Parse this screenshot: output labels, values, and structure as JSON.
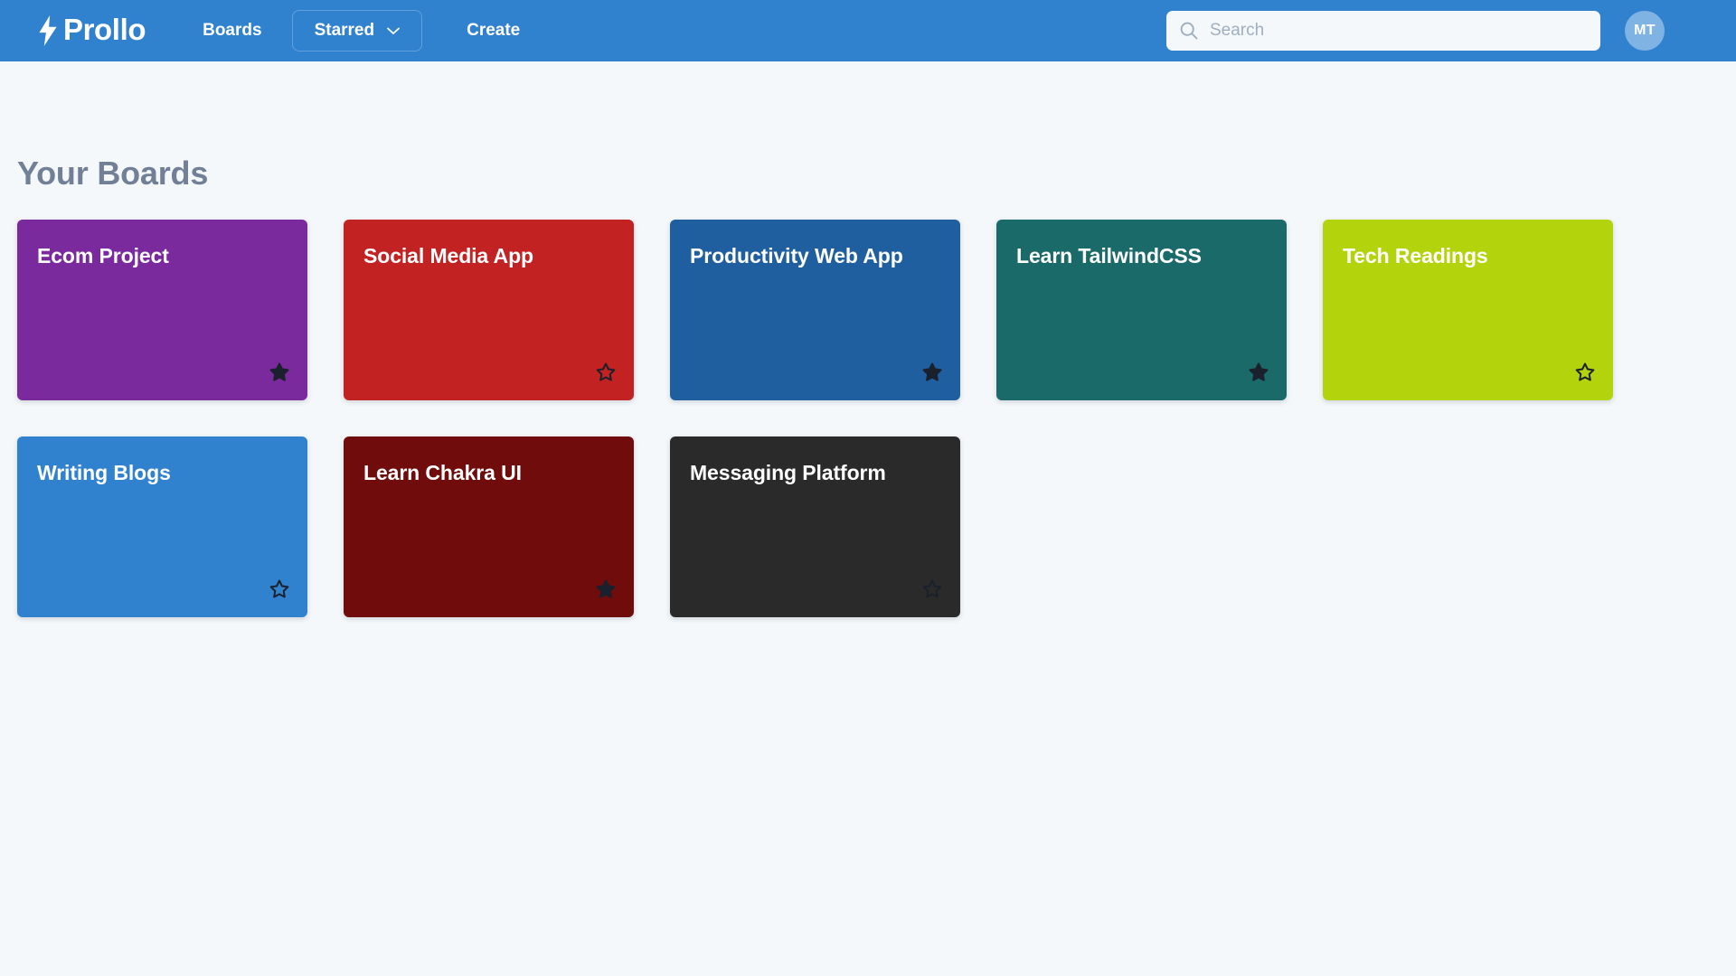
{
  "app": {
    "brand": "Prollo",
    "brand_icon": "lightning-bolt-icon",
    "navbar_color": "#3182ce",
    "page_background": "#f4f8fb"
  },
  "navbar": {
    "links": [
      {
        "label": "Boards",
        "type": "link"
      },
      {
        "label": "Starred",
        "type": "dropdown",
        "icon": "chevron-down-icon"
      },
      {
        "label": "Create",
        "type": "link"
      }
    ],
    "search": {
      "icon": "search-icon",
      "placeholder": "Search",
      "value": ""
    },
    "avatar": {
      "initials": "MT",
      "color": "#7fb3e4"
    }
  },
  "main": {
    "page_title": "Your Boards",
    "title_color": "#718096",
    "boards": [
      {
        "title": "Ecom Project",
        "color": "#7b2a9d",
        "starred": true,
        "star_icon": "star-filled-icon"
      },
      {
        "title": "Social Media App",
        "color": "#c32222",
        "starred": false,
        "star_icon": "star-outline-icon"
      },
      {
        "title": "Productivity Web App",
        "color": "#1f5fa0",
        "starred": true,
        "star_icon": "star-filled-icon"
      },
      {
        "title": "Learn TailwindCSS",
        "color": "#1b6a6a",
        "starred": true,
        "star_icon": "star-filled-icon"
      },
      {
        "title": "Tech Readings",
        "color": "#b3d40c",
        "starred": false,
        "star_icon": "star-outline-icon"
      },
      {
        "title": "Writing Blogs",
        "color": "#3182ce",
        "starred": false,
        "star_icon": "star-outline-icon"
      },
      {
        "title": "Learn Chakra UI",
        "color": "#700c0c",
        "starred": true,
        "star_icon": "star-filled-icon"
      },
      {
        "title": "Messaging Platform",
        "color": "#2b2a2a",
        "starred": false,
        "star_icon": "star-outline-icon"
      }
    ]
  }
}
